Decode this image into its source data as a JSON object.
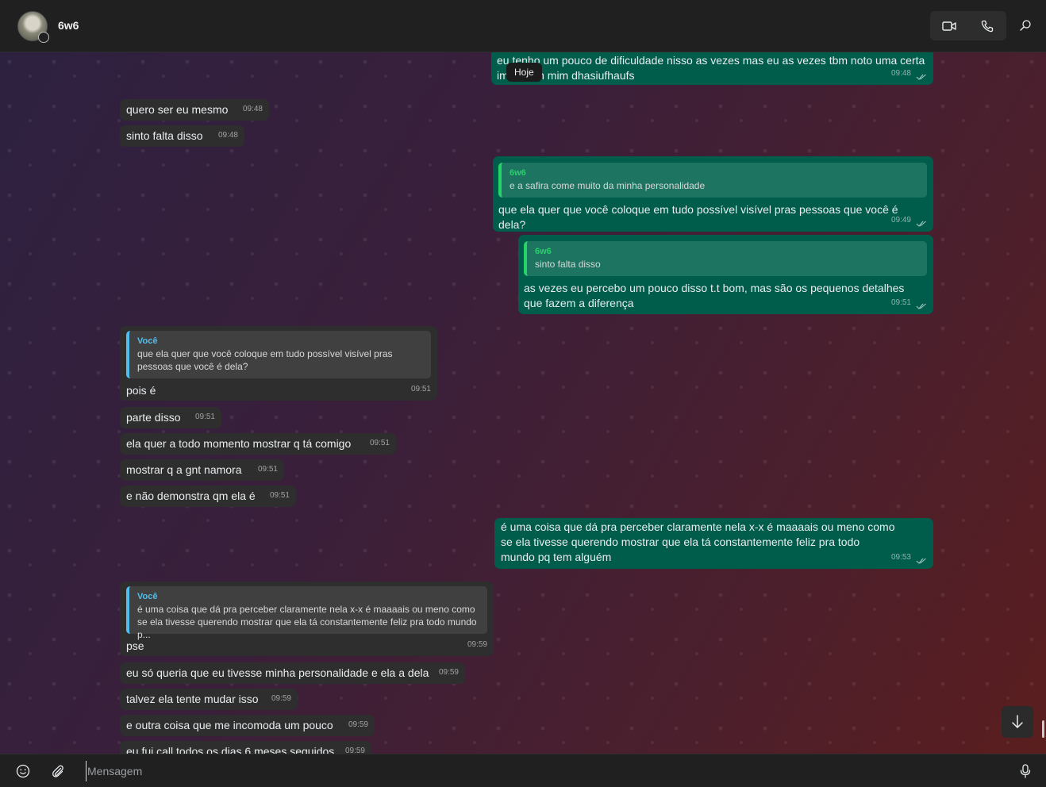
{
  "header": {
    "contact_name": "6w6",
    "video_call_icon": "video-camera-icon",
    "voice_call_icon": "phone-icon",
    "search_icon": "search-icon"
  },
  "chat": {
    "date_chip": "Hoje",
    "messages": [
      {
        "dir": "out",
        "text": "eu tenho um pouco de dificuldade nisso as vezes mas eu as vezes tbm noto uma certa im          cia em mim dhasiufhaufs",
        "time": "09:48"
      },
      {
        "dir": "in",
        "text": "quero ser eu mesmo",
        "time": "09:48"
      },
      {
        "dir": "in",
        "text": "sinto falta disso",
        "time": "09:48"
      },
      {
        "dir": "out",
        "quote_name": "6w6",
        "quote_text": "e a safira come muito da minha personalidade",
        "text": "que ela quer que você coloque em tudo possível visível pras pessoas que você é dela?",
        "time": "09:49"
      },
      {
        "dir": "out",
        "quote_name": "6w6",
        "quote_text": "sinto falta disso",
        "text": "as vezes eu percebo um pouco disso t.t bom, mas são os pequenos detalhes que fazem a diferença",
        "time": "09:51"
      },
      {
        "dir": "in",
        "quote_name": "Você",
        "quote_text": "que ela quer que você coloque em tudo possível visível pras pessoas que você é dela?",
        "text": "pois é",
        "time": "09:51"
      },
      {
        "dir": "in",
        "text": "parte disso",
        "time": "09:51"
      },
      {
        "dir": "in",
        "text": "ela quer a todo momento mostrar q tá comigo",
        "time": "09:51"
      },
      {
        "dir": "in",
        "text": "mostrar q a gnt namora",
        "time": "09:51"
      },
      {
        "dir": "in",
        "text": "e não demonstra qm ela é",
        "time": "09:51"
      },
      {
        "dir": "out",
        "text": "é uma coisa que dá pra perceber claramente nela x-x é maaaais ou meno como se ela tivesse querendo mostrar que ela tá constantemente feliz pra todo mundo pq tem alguém",
        "time": "09:53"
      },
      {
        "dir": "in",
        "quote_name": "Você",
        "quote_text": "é uma coisa que dá pra perceber claramente nela x-x é maaaais ou meno como se ela tivesse querendo mostrar que ela tá constantemente feliz pra todo mundo p...",
        "text": "pse",
        "time": "09:59"
      },
      {
        "dir": "in",
        "text": "eu só queria que eu tivesse minha personalidade e ela a dela",
        "time": "09:59"
      },
      {
        "dir": "in",
        "text": "talvez ela tente mudar isso",
        "time": "09:59"
      },
      {
        "dir": "in",
        "text": "e outra coisa que me incomoda um pouco",
        "time": "09:59"
      },
      {
        "dir": "in",
        "text": "eu fui call todos os dias 6 meses seguidos",
        "time": "09:59"
      }
    ]
  },
  "footer": {
    "emoji_icon": "emoji-icon",
    "attach_icon": "paperclip-icon",
    "input_placeholder": "Mensagem",
    "mic_icon": "microphone-icon"
  },
  "colors": {
    "incoming_bubble": "#2e2e2e",
    "outgoing_bubble": "#005c4b",
    "quote_accent_incoming": "#53bdeb",
    "quote_accent_outgoing": "#25d366"
  }
}
